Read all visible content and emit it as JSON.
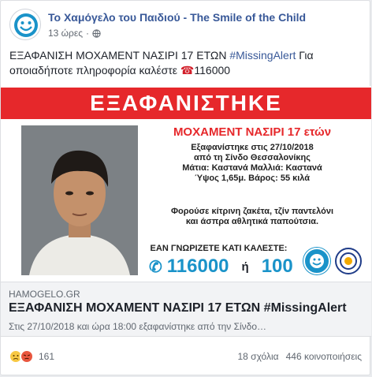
{
  "header": {
    "page_name": "Το Χαμόγελο του Παιδιού - The Smile of the Child",
    "time": "13 ώρες",
    "separator": "·",
    "avatar_icon": "smile-of-child-logo-icon",
    "privacy_icon": "globe-icon"
  },
  "post": {
    "text_start": "ΕΞΑΦΑΝΙΣΗ ΜΟΧΑΜΕΝΤ ΝΑΣΙΡΙ 17 ΕΤΩΝ ",
    "hashtag": "#MissingAlert",
    "text_end": " Για οποιαδήποτε πληροφορία καλέστε ",
    "phone_icon": "☎",
    "phone": "116000"
  },
  "flyer": {
    "banner": "ΕΞΑΦΑΝΙΣΤΗΚΕ",
    "name": "ΜΟΧΑΜΕΝΤ ΝΑΣΙΡΙ 17 ετών",
    "info_line1": "Εξαφανίστηκε στις 27/10/2018",
    "info_line2": "από τη Σίνδο Θεσσαλονίκης",
    "info_line3": "Μάτια: Καστανά Μαλλιά: Καστανά",
    "info_line4": "Ύψος 1,65μ. Βάρος: 55 κιλά",
    "clothes_line1": "Φορούσε κίτρινη ζακέτα, τζίν παντελόνι",
    "clothes_line2": "και άσπρα αθλητικά παπούτσια.",
    "call_label": "ΕΑΝ ΓΝΩΡΙΖΕΤΕ ΚΑΤΙ ΚΑΛΕΣΤΕ:",
    "hotline_icon": "✆",
    "hotline": "116000",
    "or": "ή",
    "hotline2": "100",
    "colors": {
      "banner": "#e6282b",
      "hotline": "#1a93c9"
    }
  },
  "link": {
    "domain": "HAMOGELO.GR",
    "title": "ΕΞΑΦΑΝΙΣΗ ΜΟΧΑΜΕΝΤ ΝΑΣΙΡΙ 17 ΕΤΩΝ #MissingAlert",
    "description": "Στις 27/10/2018 και ώρα 18:00 εξαφανίστηκε από την Σίνδο…"
  },
  "footer": {
    "reaction_icons": [
      "sad-reaction-icon",
      "angry-reaction-icon"
    ],
    "reaction_count": "161",
    "comments": "18 σχόλια",
    "shares": "446 κοινοποιήσεις"
  }
}
